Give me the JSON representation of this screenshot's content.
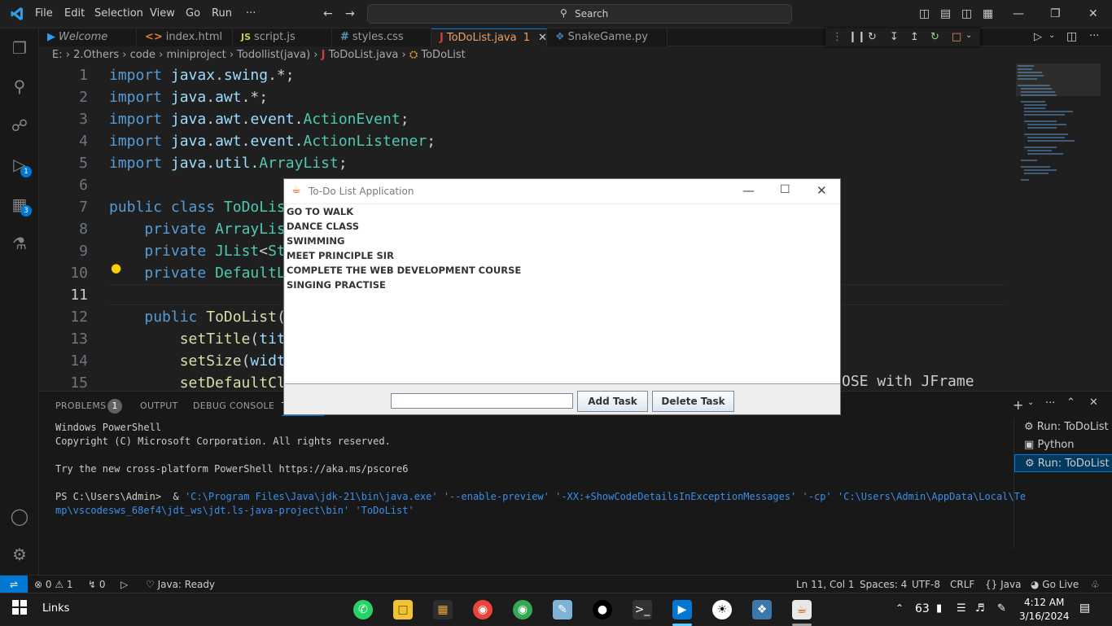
{
  "titlebar": {
    "menu": [
      "File",
      "Edit",
      "Selection",
      "View",
      "Go",
      "Run",
      "···"
    ],
    "search_placeholder": "Search"
  },
  "tabs": [
    {
      "label": "Welcome",
      "icon": "vscode-icon"
    },
    {
      "label": "index.html",
      "icon": "html-icon"
    },
    {
      "label": "script.js",
      "icon": "js-icon"
    },
    {
      "label": "styles.css",
      "icon": "css-icon"
    },
    {
      "label": "ToDoList.java",
      "icon": "java-icon",
      "badge": "1",
      "active": true
    },
    {
      "label": "SnakeGame.py",
      "icon": "python-icon"
    }
  ],
  "breadcrumb": [
    "E:",
    "2.Others",
    "code",
    "miniproject",
    "Todollist(java)",
    "ToDoList.java",
    "ToDoList"
  ],
  "activity": {
    "debug_badge": "1",
    "extensions_badge": "3"
  },
  "editor": {
    "lines": [
      {
        "n": "1",
        "parts": [
          [
            "kw",
            "import"
          ],
          [
            "",
            " "
          ],
          [
            "va",
            "javax"
          ],
          [
            "",
            "."
          ],
          [
            "va",
            "swing"
          ],
          [
            "",
            ".*;"
          ]
        ]
      },
      {
        "n": "2",
        "parts": [
          [
            "kw",
            "import"
          ],
          [
            "",
            " "
          ],
          [
            "va",
            "java"
          ],
          [
            "",
            "."
          ],
          [
            "va",
            "awt"
          ],
          [
            "",
            ".*;"
          ]
        ]
      },
      {
        "n": "3",
        "parts": [
          [
            "kw",
            "import"
          ],
          [
            "",
            " "
          ],
          [
            "va",
            "java"
          ],
          [
            "",
            "."
          ],
          [
            "va",
            "awt"
          ],
          [
            "",
            "."
          ],
          [
            "va",
            "event"
          ],
          [
            "",
            "."
          ],
          [
            "ty",
            "ActionEvent"
          ],
          [
            "",
            ";"
          ]
        ]
      },
      {
        "n": "4",
        "parts": [
          [
            "kw",
            "import"
          ],
          [
            "",
            " "
          ],
          [
            "va",
            "java"
          ],
          [
            "",
            "."
          ],
          [
            "va",
            "awt"
          ],
          [
            "",
            "."
          ],
          [
            "va",
            "event"
          ],
          [
            "",
            "."
          ],
          [
            "ty",
            "ActionListener"
          ],
          [
            "",
            ";"
          ]
        ]
      },
      {
        "n": "5",
        "parts": [
          [
            "kw",
            "import"
          ],
          [
            "",
            " "
          ],
          [
            "va",
            "java"
          ],
          [
            "",
            "."
          ],
          [
            "va",
            "util"
          ],
          [
            "",
            "."
          ],
          [
            "ty",
            "ArrayList"
          ],
          [
            "",
            ";"
          ]
        ]
      },
      {
        "n": "6",
        "parts": []
      },
      {
        "n": "7",
        "parts": [
          [
            "kw",
            "public"
          ],
          [
            "",
            " "
          ],
          [
            "kw",
            "class"
          ],
          [
            "",
            " "
          ],
          [
            "ty",
            "ToDoLis"
          ]
        ]
      },
      {
        "n": "8",
        "parts": [
          [
            "",
            "    "
          ],
          [
            "kw",
            "private"
          ],
          [
            "",
            " "
          ],
          [
            "ty",
            "ArrayLis"
          ]
        ]
      },
      {
        "n": "9",
        "parts": [
          [
            "",
            "    "
          ],
          [
            "kw",
            "private"
          ],
          [
            "",
            " "
          ],
          [
            "ty",
            "JList"
          ],
          [
            "",
            "<"
          ],
          [
            "ty",
            "St"
          ]
        ]
      },
      {
        "n": "10",
        "parts": [
          [
            "",
            "    "
          ],
          [
            "kw",
            "private"
          ],
          [
            "",
            " "
          ],
          [
            "ty",
            "DefaultL"
          ]
        ]
      },
      {
        "n": "11",
        "parts": []
      },
      {
        "n": "12",
        "parts": [
          [
            "",
            "    "
          ],
          [
            "kw",
            "public"
          ],
          [
            "",
            " "
          ],
          [
            "fn",
            "ToDoList"
          ],
          [
            "",
            "("
          ]
        ]
      },
      {
        "n": "13",
        "parts": [
          [
            "",
            "        "
          ],
          [
            "fn",
            "setTitle"
          ],
          [
            "",
            "("
          ],
          [
            "va",
            "tit"
          ]
        ]
      },
      {
        "n": "14",
        "parts": [
          [
            "",
            "        "
          ],
          [
            "fn",
            "setSize"
          ],
          [
            "",
            "("
          ],
          [
            "va",
            "widt"
          ]
        ]
      },
      {
        "n": "15",
        "parts": [
          [
            "",
            "        "
          ],
          [
            "fn",
            "setDefaultCl"
          ]
        ]
      }
    ],
    "line15_tail": "OSE with JFrame"
  },
  "panel": {
    "tabs": [
      "PROBLEMS",
      "OUTPUT",
      "DEBUG CONSOLE",
      "T"
    ],
    "problems_count": "1",
    "terminal": [
      "Windows PowerShell",
      "Copyright (C) Microsoft Corporation. All rights reserved.",
      "",
      "Try the new cross-platform PowerShell https://aka.ms/pscore6",
      ""
    ],
    "prompt": "PS C:\\Users\\Admin>  & ",
    "cmd1": "'C:\\Program Files\\Java\\jdk-21\\bin\\java.exe' '--enable-preview' '-XX:+ShowCodeDetailsInExceptionMessages' '-cp' 'C:\\Users\\Admin\\AppData\\Local\\Te",
    "cmd2": "mp\\vscodesws_68ef4\\jdt_ws\\jdt.ls-java-project\\bin' 'ToDoList'",
    "terminals": [
      "Run: ToDoList",
      "Python",
      "Run: ToDoList"
    ]
  },
  "statusbar": {
    "errors": "0",
    "warnings": "1",
    "ports": "0",
    "java_status": "Java: Ready",
    "position": "Ln 11, Col 1",
    "spaces": "Spaces: 4",
    "encoding": "UTF-8",
    "eol": "CRLF",
    "language": "Java",
    "golive": "Go Live"
  },
  "taskbar": {
    "links": "Links",
    "temp": "63",
    "time": "4:12 AM",
    "date": "3/16/2024"
  },
  "java_app": {
    "title": "To-Do List Application",
    "tasks": [
      "GO TO WALK",
      "DANCE CLASS",
      "SWIMMING",
      "MEET PRINCIPLE SIR",
      "COMPLETE THE WEB DEVELOPMENT COURSE",
      "SINGING PRACTISE"
    ],
    "task_input_value": "",
    "add_label": "Add Task",
    "delete_label": "Delete Task"
  }
}
